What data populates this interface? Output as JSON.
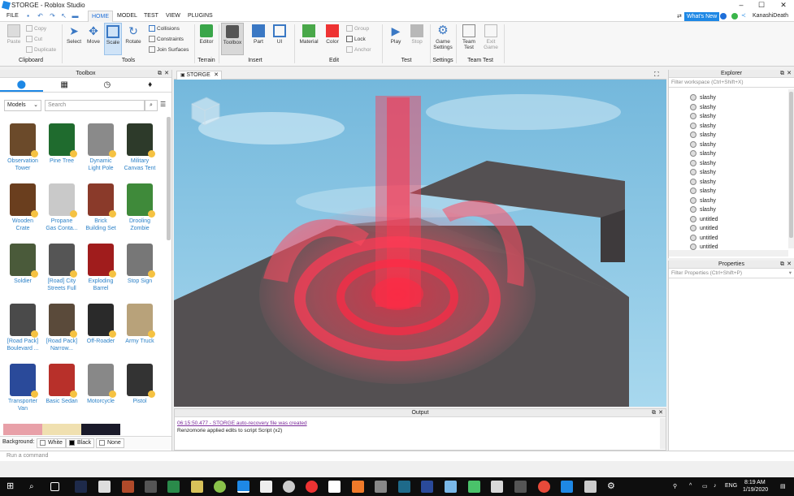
{
  "window": {
    "title": "STORGE - Roblox Studio",
    "min": "–",
    "max": "☐",
    "close": "✕"
  },
  "menubar": {
    "file": "FILE",
    "tabs": [
      "HOME",
      "MODEL",
      "TEST",
      "VIEW",
      "PLUGINS"
    ],
    "whats_new": "What's New",
    "username": "KanashiDeath"
  },
  "ribbon": {
    "clipboard": {
      "paste": "Paste",
      "copy": "Copy",
      "cut": "Cut",
      "duplicate": "Duplicate",
      "label": "Clipboard"
    },
    "tools": {
      "select": "Select",
      "move": "Move",
      "scale": "Scale",
      "rotate": "Rotate",
      "collisions": "Collisions",
      "constraints": "Constraints",
      "join_surfaces": "Join Surfaces",
      "label": "Tools"
    },
    "terrain": {
      "editor": "Editor",
      "label": "Terrain"
    },
    "insert": {
      "toolbox": "Toolbox",
      "part": "Part",
      "ui": "UI",
      "label": "Insert"
    },
    "edit": {
      "material": "Material",
      "color": "Color",
      "group": "Group",
      "lock": "Lock",
      "anchor": "Anchor",
      "label": "Edit"
    },
    "test": {
      "play": "Play",
      "stop": "Stop",
      "label": "Test"
    },
    "settings": {
      "game_settings_1": "Game",
      "game_settings_2": "Settings",
      "label": "Settings"
    },
    "team_test": {
      "team_test_1": "Team",
      "team_test_2": "Test",
      "exit_game_1": "Exit",
      "exit_game_2": "Game",
      "label": "Team Test"
    }
  },
  "toolbox": {
    "title": "Toolbox",
    "category": "Models",
    "search_placeholder": "Search",
    "items": [
      {
        "l1": "Observation",
        "l2": "Tower",
        "color": "#6b4a2a"
      },
      {
        "l1": "Pine Tree",
        "l2": "",
        "color": "#1f6b2e"
      },
      {
        "l1": "Dynamic",
        "l2": "Light Pole",
        "color": "#8a8a8a"
      },
      {
        "l1": "Military",
        "l2": "Canvas Tent",
        "color": "#2d3a2a"
      },
      {
        "l1": "Wooden",
        "l2": "Crate",
        "color": "#6a3e1e"
      },
      {
        "l1": "Propane",
        "l2": "Gas Conta...",
        "color": "#c9c9c9"
      },
      {
        "l1": "Brick",
        "l2": "Building Set",
        "color": "#8a3a2a"
      },
      {
        "l1": "Drooling",
        "l2": "Zombie",
        "color": "#3f8a3a"
      },
      {
        "l1": "Soldier",
        "l2": "",
        "color": "#4a5a3a"
      },
      {
        "l1": "[Road] City",
        "l2": "Streets Full",
        "color": "#555555"
      },
      {
        "l1": "Exploding",
        "l2": "Barrel",
        "color": "#a01c1c"
      },
      {
        "l1": "Stop Sign",
        "l2": "",
        "color": "#777777"
      },
      {
        "l1": "[Road Pack]",
        "l2": "Boulevard ...",
        "color": "#4a4a4a"
      },
      {
        "l1": "[Road Pack]",
        "l2": "Narrow...",
        "color": "#5a4a3a"
      },
      {
        "l1": "Off-Roader",
        "l2": "",
        "color": "#2a2a2a"
      },
      {
        "l1": "Army Truck",
        "l2": "",
        "color": "#b8a27a"
      },
      {
        "l1": "Transporter",
        "l2": "Van",
        "color": "#2a4a9a"
      },
      {
        "l1": "Basic Sedan",
        "l2": "",
        "color": "#b8302a"
      },
      {
        "l1": "Motorcycle",
        "l2": "",
        "color": "#888888"
      },
      {
        "l1": "Pistol",
        "l2": "",
        "color": "#333333"
      }
    ],
    "background_label": "Background:",
    "bg_white": "White",
    "bg_black": "Black",
    "bg_none": "None"
  },
  "document": {
    "tab": "STORGE"
  },
  "output": {
    "title": "Output",
    "line1": "06:15:50.477 - STORGE auto-recovery file was created",
    "line2": "Renzomorie applied edits to script Script (x2)"
  },
  "explorer": {
    "title": "Explorer",
    "filter": "Filter workspace (Ctrl+Shift+X)",
    "items": [
      "slashy",
      "slashy",
      "slashy",
      "slashy",
      "slashy",
      "slashy",
      "slashy",
      "slashy",
      "slashy",
      "slashy",
      "slashy",
      "slashy",
      "slashy",
      "untitled",
      "untitled",
      "untitled",
      "untitled"
    ]
  },
  "properties": {
    "title": "Properties",
    "filter": "Filter Properties (Ctrl+Shift+P)"
  },
  "command_bar": {
    "placeholder": "Run a command"
  },
  "taskbar": {
    "lang": "ENG",
    "time": "8:19 AM",
    "date": "1/19/2020"
  },
  "colors": {
    "accent": "#1e88e5",
    "sky": "#7ec0e2",
    "effect": "#ff3b55",
    "floor": "#545052"
  }
}
